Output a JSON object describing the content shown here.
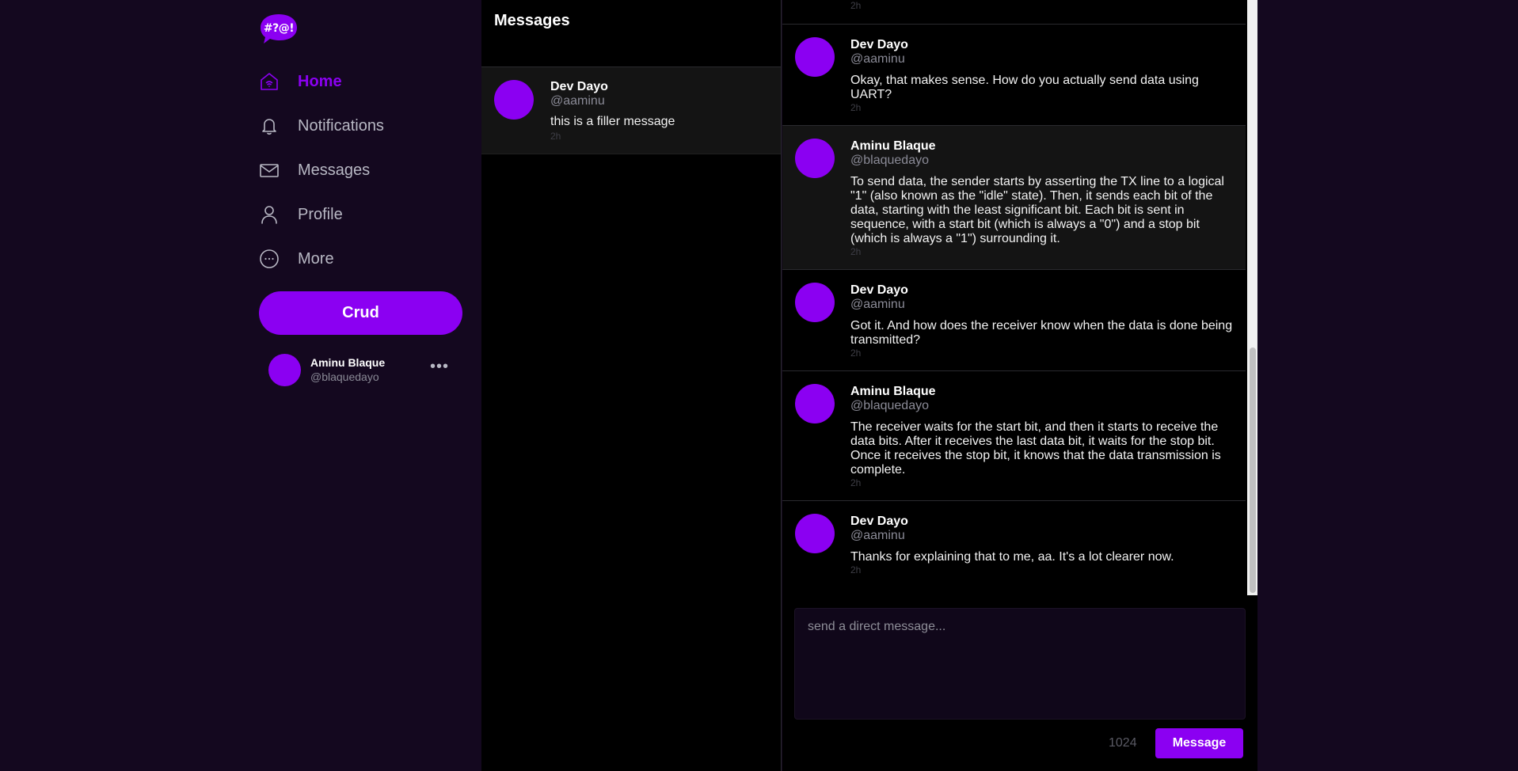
{
  "app": {
    "logo_text": "#?@!",
    "accent_color": "#8b00f2"
  },
  "nav": {
    "items": [
      {
        "label": "Home",
        "icon": "home-icon",
        "active": true
      },
      {
        "label": "Notifications",
        "icon": "bell-icon",
        "active": false
      },
      {
        "label": "Messages",
        "icon": "envelope-icon",
        "active": false
      },
      {
        "label": "Profile",
        "icon": "user-icon",
        "active": false
      },
      {
        "label": "More",
        "icon": "more-circle-icon",
        "active": false
      }
    ],
    "crud_label": "Crud"
  },
  "current_user": {
    "name": "Aminu Blaque",
    "handle": "@blaquedayo",
    "menu_icon": "ellipsis-icon"
  },
  "conversations": {
    "title": "Messages",
    "items": [
      {
        "name": "Dev Dayo",
        "handle": "@aaminu",
        "preview": "this is a filler message",
        "time": "2h"
      }
    ]
  },
  "chat": {
    "top_stub_time": "2h",
    "messages": [
      {
        "name": "Dev Dayo",
        "handle": "@aaminu",
        "text": "Okay, that makes sense. How do you actually send data using UART?",
        "time": "2h",
        "alt": false
      },
      {
        "name": "Aminu Blaque",
        "handle": "@blaquedayo",
        "text": "To send data, the sender starts by asserting the TX line to a logical \"1\" (also known as the \"idle\" state). Then, it sends each bit of the data, starting with the least significant bit. Each bit is sent in sequence, with a start bit (which is always a \"0\") and a stop bit (which is always a \"1\") surrounding it.",
        "time": "2h",
        "alt": true
      },
      {
        "name": "Dev Dayo",
        "handle": "@aaminu",
        "text": "Got it. And how does the receiver know when the data is done being transmitted?",
        "time": "2h",
        "alt": false
      },
      {
        "name": "Aminu Blaque",
        "handle": "@blaquedayo",
        "text": "The receiver waits for the start bit, and then it starts to receive the data bits. After it receives the last data bit, it waits for the stop bit. Once it receives the stop bit, it knows that the data transmission is complete.",
        "time": "2h",
        "alt": false
      },
      {
        "name": "Dev Dayo",
        "handle": "@aaminu",
        "text": "Thanks for explaining that to me, aa. It's a lot clearer now.",
        "time": "2h",
        "alt": false
      }
    ],
    "composer_placeholder": "send a direct message...",
    "char_count": "1024",
    "send_label": "Message"
  }
}
